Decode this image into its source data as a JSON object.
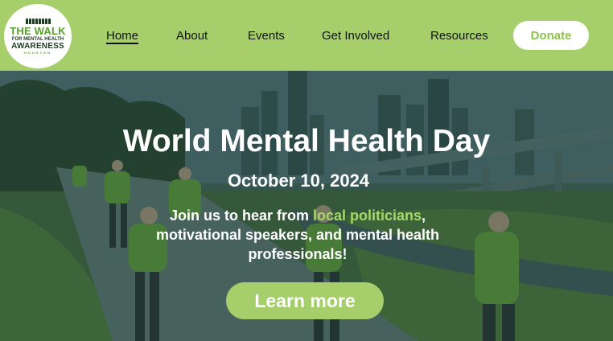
{
  "logo": {
    "line1": "THE WALK",
    "line2": "FOR MENTAL HEALTH",
    "line3": "AWARENESS",
    "line4": "HOUSTON"
  },
  "nav": {
    "items": [
      {
        "label": "Home",
        "active": true
      },
      {
        "label": "About",
        "active": false
      },
      {
        "label": "Events",
        "active": false
      },
      {
        "label": "Get Involved",
        "active": false
      },
      {
        "label": "Resources",
        "active": false
      }
    ],
    "donate_label": "Donate"
  },
  "hero": {
    "title": "World Mental Health Day",
    "date": "October 10, 2024",
    "desc_before": "Join us to hear from ",
    "desc_highlight": "local politicians",
    "desc_after": ", motivational speakers, and mental health professionals!",
    "cta_label": "Learn more"
  },
  "colors": {
    "brand_green": "#a6cf6c",
    "highlight_green": "#a6d86b",
    "text_dark": "#111111",
    "white": "#ffffff"
  }
}
